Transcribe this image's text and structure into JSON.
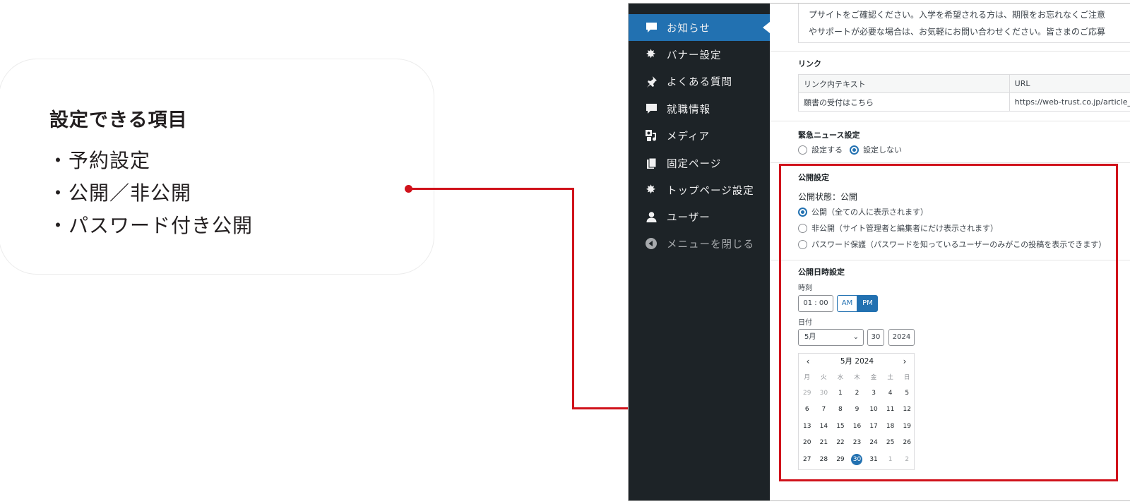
{
  "callout": {
    "title": "設定できる項目",
    "items": [
      "予約設定",
      "公開／非公開",
      "パスワード付き公開"
    ]
  },
  "sidebar": {
    "items": [
      {
        "label": "お知らせ",
        "icon": "speech-bubble-icon",
        "active": true
      },
      {
        "label": "バナー設定",
        "icon": "gear-icon"
      },
      {
        "label": "よくある質問",
        "icon": "pin-icon"
      },
      {
        "label": "就職情報",
        "icon": "speech-bubble-icon"
      },
      {
        "label": "メディア",
        "icon": "media-icon"
      },
      {
        "label": "固定ページ",
        "icon": "pages-icon"
      },
      {
        "label": "トップページ設定",
        "icon": "gear-icon"
      },
      {
        "label": "ユーザー",
        "icon": "user-icon"
      },
      {
        "label": "メニューを閉じる",
        "icon": "collapse-icon",
        "dim": true
      }
    ]
  },
  "notice": {
    "line1": "プサイトをご確認ください。入学を希望される方は、期限をお忘れなくご注意",
    "line2": "やサポートが必要な場合は、お気軽にお問い合わせください。皆さまのご応募"
  },
  "links": {
    "label": "リンク",
    "headers": [
      "リンク内テキスト",
      "URL"
    ],
    "rows": [
      [
        "願書の受付はこちら",
        "https://web-trust.co.jp/article_"
      ]
    ]
  },
  "emergency": {
    "label": "緊急ニュース設定",
    "options": [
      "設定する",
      "設定しない"
    ],
    "selected": "設定しない"
  },
  "publish": {
    "label": "公開設定",
    "status": "公開状態：公開",
    "options": [
      "公開（全ての人に表示されます）",
      "非公開（サイト管理者と編集者にだけ表示されます）",
      "パスワード保護（パスワードを知っているユーザーのみがこの投稿を表示できます）"
    ],
    "selected": "公開（全ての人に表示されます）"
  },
  "schedule": {
    "label": "公開日時設定",
    "time_label": "時刻",
    "time_value": "01 : 00",
    "am": "AM",
    "pm": "PM",
    "ampm_selected": "PM",
    "date_label": "日付",
    "month_select": "5月",
    "day": "30",
    "year": "2024",
    "calendar": {
      "title": "5月 2024",
      "weekdays": [
        "月",
        "火",
        "水",
        "木",
        "金",
        "土",
        "日"
      ],
      "weeks": [
        [
          "29",
          "30",
          "1",
          "2",
          "3",
          "4",
          "5"
        ],
        [
          "6",
          "7",
          "8",
          "9",
          "10",
          "11",
          "12"
        ],
        [
          "13",
          "14",
          "15",
          "16",
          "17",
          "18",
          "19"
        ],
        [
          "20",
          "21",
          "22",
          "23",
          "24",
          "25",
          "26"
        ],
        [
          "27",
          "28",
          "29",
          "30",
          "31",
          "1",
          "2"
        ]
      ],
      "selected_day": "30"
    }
  },
  "colors": {
    "accent": "#2271b1",
    "sidebar_bg": "#1d2327",
    "highlight_red": "#d0121b"
  }
}
